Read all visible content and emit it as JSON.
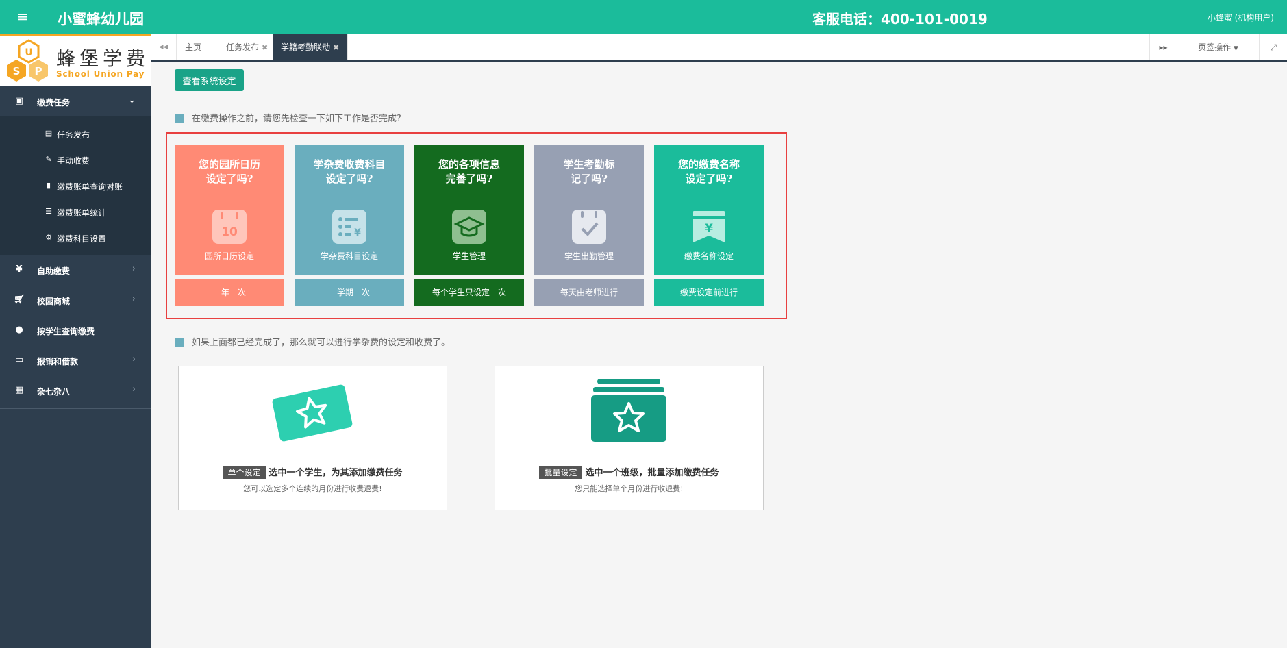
{
  "header": {
    "brand": "小蜜蜂幼儿园",
    "hotline": "客服电话：400-101-0019",
    "user": "小蜂蜜 (机构用户)",
    "accent": "#1bbc9b"
  },
  "logo": {
    "cn": "蜂堡学费",
    "en": "School Union Pay"
  },
  "sidebar": {
    "group": {
      "label": "缴费任务",
      "icon": "money-icon"
    },
    "subitems": [
      {
        "label": "任务发布",
        "icon": "file-icon"
      },
      {
        "label": "手动收费",
        "icon": "edit-icon"
      },
      {
        "label": "缴费账单查询对账",
        "icon": "doc-icon"
      },
      {
        "label": "缴费账单统计",
        "icon": "list-icon"
      },
      {
        "label": "缴费科目设置",
        "icon": "gear-icon"
      }
    ],
    "items": [
      {
        "label": "自助缴费",
        "icon": "yen-icon",
        "arrow": true
      },
      {
        "label": "校园商城",
        "icon": "cart-icon",
        "arrow": true
      },
      {
        "label": "按学生查询缴费",
        "icon": "user-icon",
        "arrow": false
      },
      {
        "label": "报销和借款",
        "icon": "card-icon",
        "arrow": true
      },
      {
        "label": "杂七杂八",
        "icon": "grid-icon",
        "arrow": true
      }
    ]
  },
  "tabs": {
    "items": [
      {
        "label": "主页",
        "closable": false
      },
      {
        "label": "任务发布",
        "closable": true
      },
      {
        "label": "学籍考勤联动",
        "closable": true,
        "active": true
      }
    ],
    "page_ops": "页签操作"
  },
  "main": {
    "sys_button": "查看系统设定",
    "hint1": "在缴费操作之前，请您先检查一下如下工作是否完成?",
    "hint2": "如果上面都已经完成了，那么就可以进行学杂费的设定和收费了。",
    "cards": [
      {
        "title1": "您的园所日历",
        "title2": "设定了吗?",
        "label": "园所日历设定",
        "freq": "一年一次",
        "icon": "calendar-icon",
        "color": "#ff8a75",
        "bottom": "#ff8a75"
      },
      {
        "title1": "学杂费收费科目",
        "title2": "设定了吗?",
        "label": "学杂费科目设定",
        "freq": "一学期一次",
        "icon": "fee-list-icon",
        "color": "#6aaebe",
        "bottom": "#6aaebe"
      },
      {
        "title1": "您的各项信息",
        "title2": "完善了吗?",
        "label": "学生管理",
        "freq": "每个学生只设定一次",
        "icon": "graduation-cap-icon",
        "color": "#146b1f",
        "bottom": "#146b1f"
      },
      {
        "title1": "学生考勤标",
        "title2": "记了吗?",
        "label": "学生出勤管理",
        "freq": "每天由老师进行",
        "icon": "attendance-check-icon",
        "color": "#97a0b3",
        "bottom": "#97a0b3"
      },
      {
        "title1": "您的缴费名称",
        "title2": "设定了吗?",
        "label": "缴费名称设定",
        "freq": "缴费设定前进行",
        "icon": "yen-bookmark-icon",
        "color": "#1bbc9b",
        "bottom": "#1bbc9b"
      }
    ],
    "ops": [
      {
        "tag": "单个设定",
        "title": "选中一个学生，为其添加缴费任务",
        "note": "您可以选定多个连续的月份进行收费退费!",
        "icon": "single-ticket-star-icon"
      },
      {
        "tag": "批量设定",
        "title": "选中一个班级，批量添加缴费任务",
        "note": "您只能选择单个月份进行收退费!",
        "icon": "batch-stack-star-icon"
      }
    ]
  }
}
